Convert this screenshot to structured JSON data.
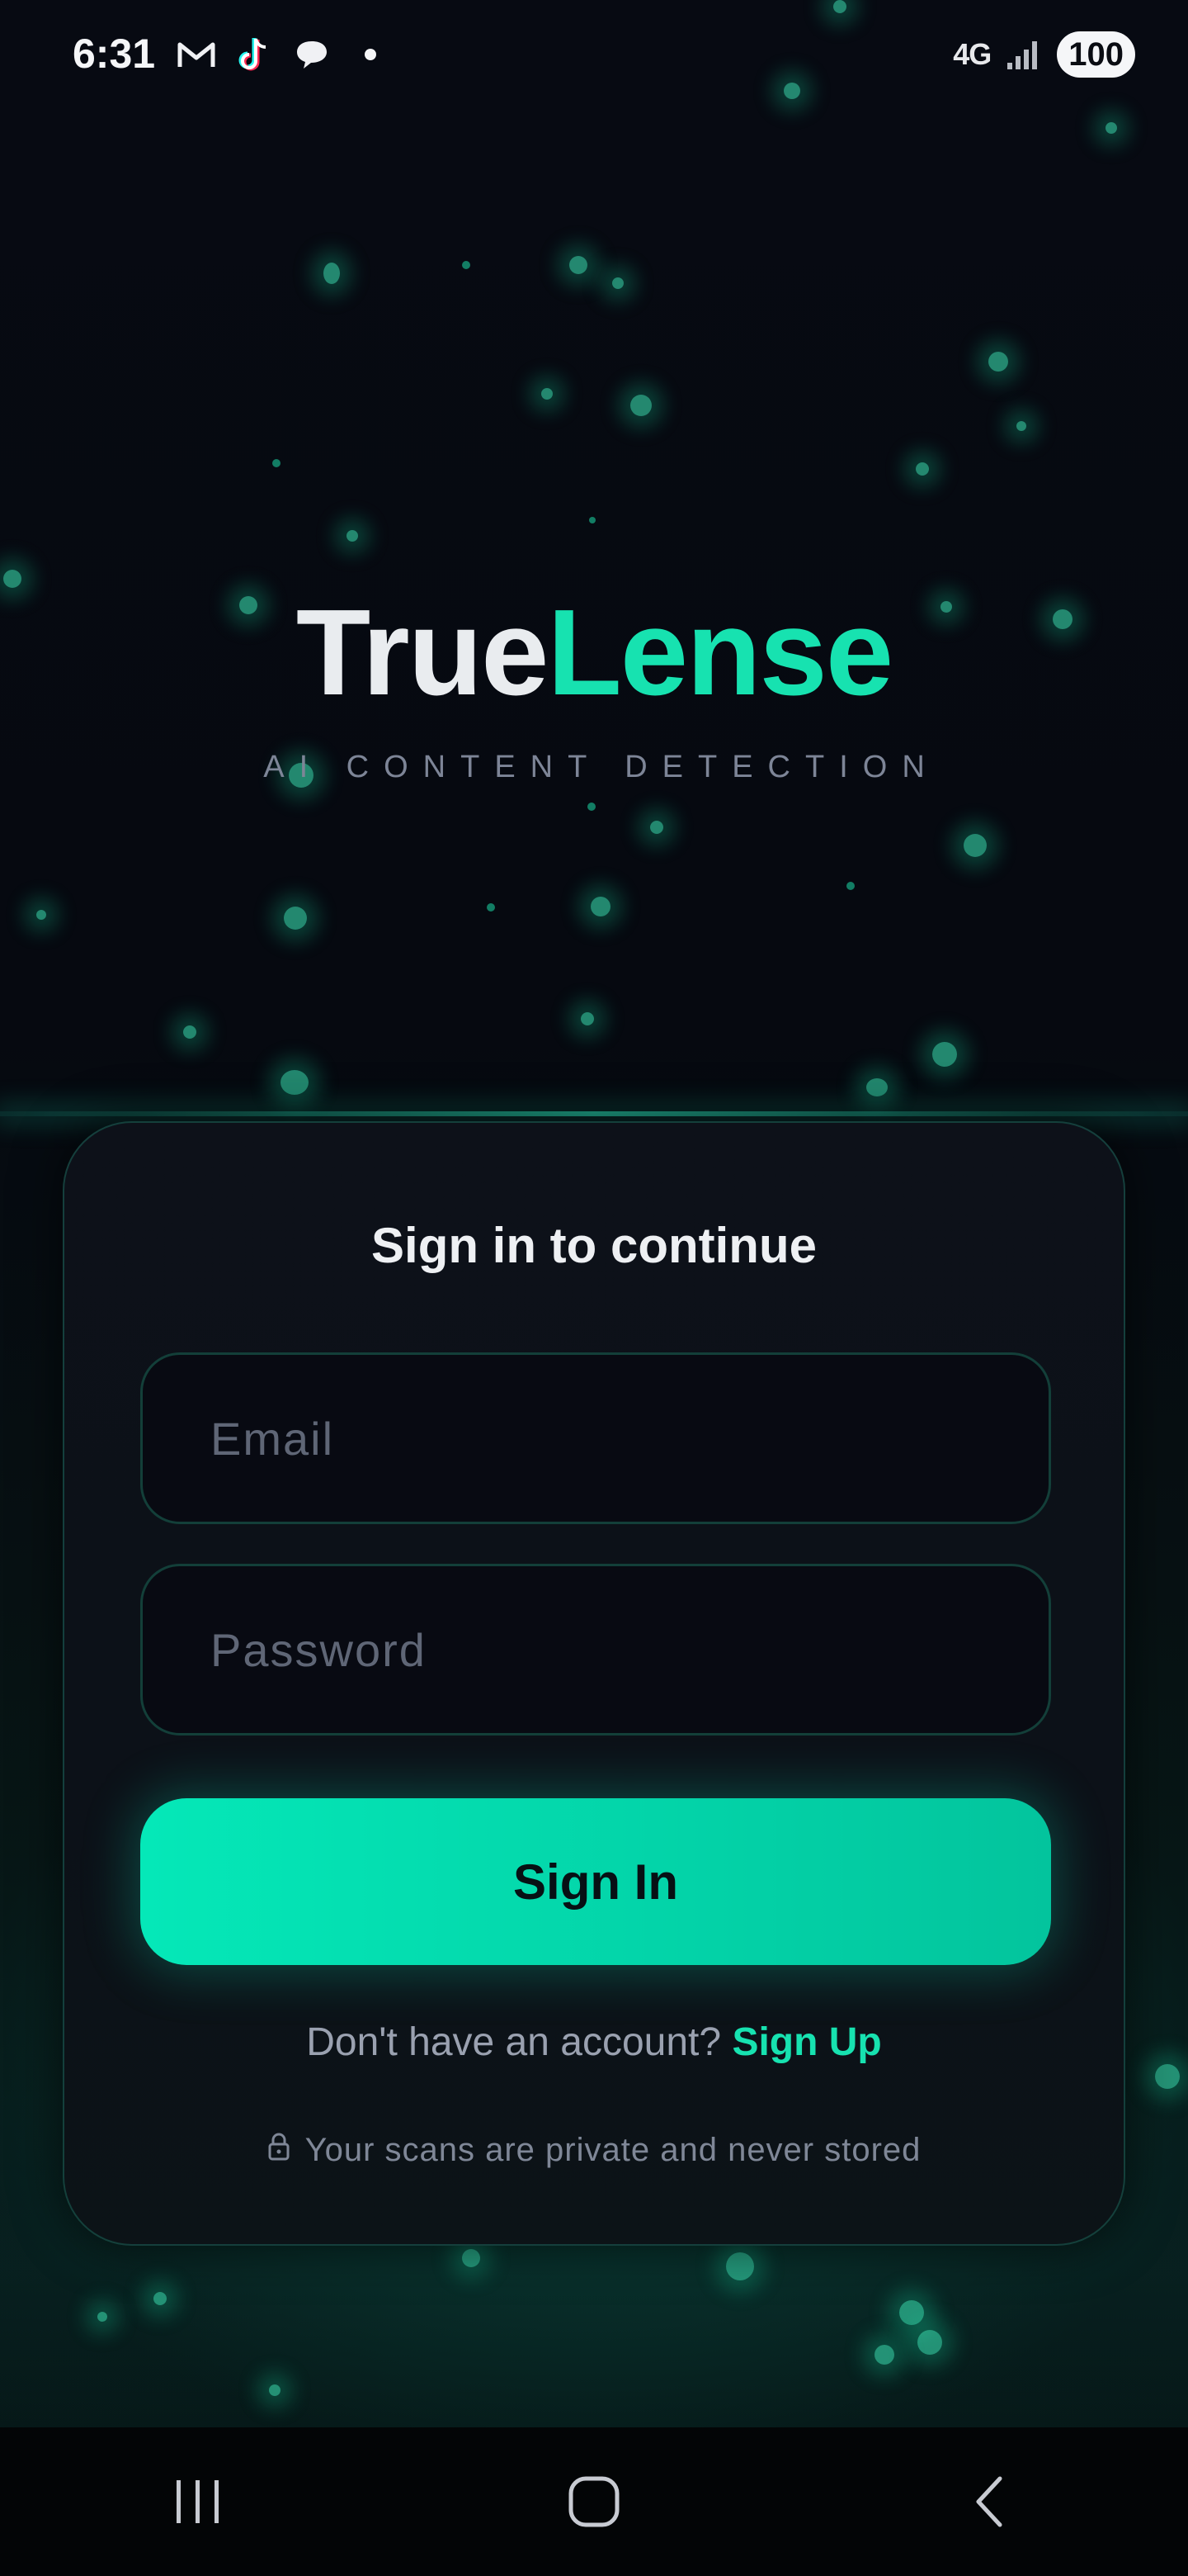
{
  "status_bar": {
    "time": "6:31",
    "icons_left": [
      "gmail-icon",
      "tiktok-icon",
      "chat-icon",
      "notification-dot"
    ],
    "network": "4G",
    "battery": "100"
  },
  "hero": {
    "brand_part1": "True",
    "brand_part2": "Lense",
    "tagline": "AI CONTENT DETECTION"
  },
  "form": {
    "title": "Sign in to continue",
    "email_placeholder": "Email",
    "password_placeholder": "Password",
    "submit_label": "Sign In",
    "signup_prompt": "Don't have an account?",
    "signup_link": "Sign Up",
    "privacy_note": "Your scans are private and never stored"
  },
  "colors": {
    "accent": "#17E2B0",
    "background": "#070A12",
    "card": "#0D1119"
  },
  "nav_bar": {
    "buttons": [
      "recent-apps-icon",
      "home-icon",
      "back-icon"
    ]
  }
}
